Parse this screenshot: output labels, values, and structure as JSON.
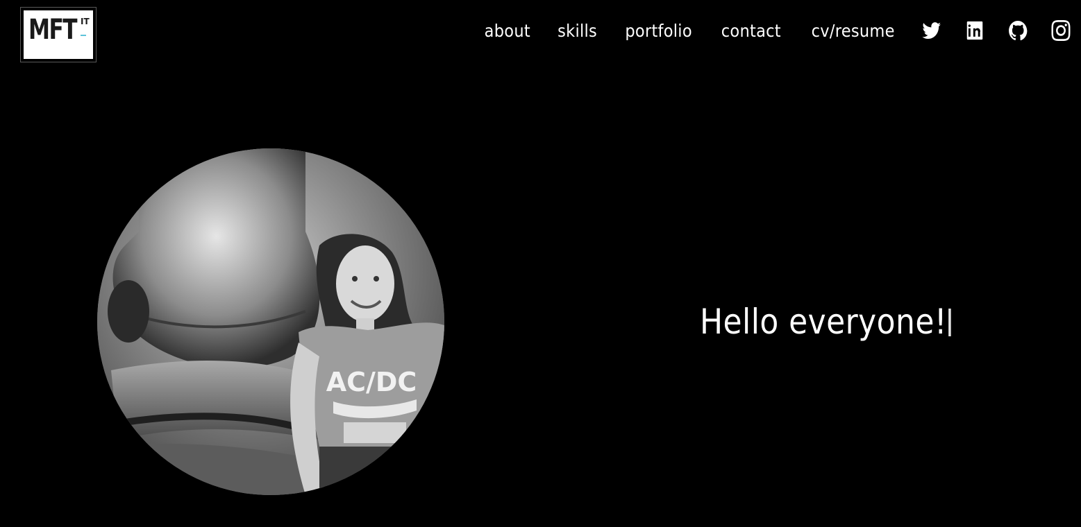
{
  "logo": {
    "text": "MFT",
    "superscript": "IT",
    "accent_color": "#5ec3d9"
  },
  "nav": {
    "links": [
      {
        "label": "about"
      },
      {
        "label": "skills"
      },
      {
        "label": "portfolio"
      },
      {
        "label": "contact"
      },
      {
        "label": "cv/resume"
      }
    ],
    "social_icons": [
      {
        "icon": "twitter-icon"
      },
      {
        "icon": "linkedin-icon"
      },
      {
        "icon": "github-icon"
      },
      {
        "icon": "instagram-icon"
      }
    ]
  },
  "hero": {
    "greeting": "Hello everyone!"
  },
  "colors": {
    "background": "#000000",
    "text": "#ffffff"
  }
}
